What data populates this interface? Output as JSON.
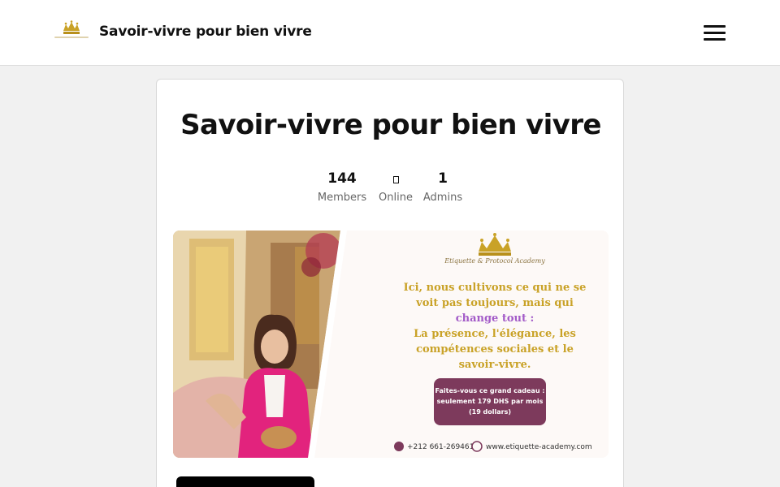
{
  "header": {
    "title": "Savoir-vivre pour bien vivre",
    "logo_icon": "crown-logo-icon",
    "logo_text": "Etiquette & Protocol Academy",
    "menu_icon": "hamburger-menu-icon"
  },
  "group": {
    "title": "Savoir-vivre pour bien vivre",
    "stats": {
      "members": {
        "value": "144",
        "label": "Members"
      },
      "online": {
        "value": "",
        "label": "Online"
      },
      "admins": {
        "value": "1",
        "label": "Admins"
      }
    }
  },
  "banner": {
    "academy_name": "Etiquette & Protocol Academy",
    "lines": [
      "Ici, nous cultivons ce qui ne se",
      "voit pas toujours, mais qui",
      "change tout :",
      "La présence, l'élégance, les",
      "compétences sociales et le",
      "savoir-vivre."
    ],
    "offer_lines": [
      "Faites-vous ce grand cadeau :",
      "seulement 179 DHS par mois",
      "(19 dollars)"
    ],
    "phone": "+212 661-269461",
    "website": "www.etiquette-academy.com"
  },
  "colors": {
    "gold": "#c9a227",
    "purple": "#a35bc8",
    "plum": "#7d3a5c",
    "page_bg": "#f1f1f1",
    "button_bg": "#000000"
  }
}
